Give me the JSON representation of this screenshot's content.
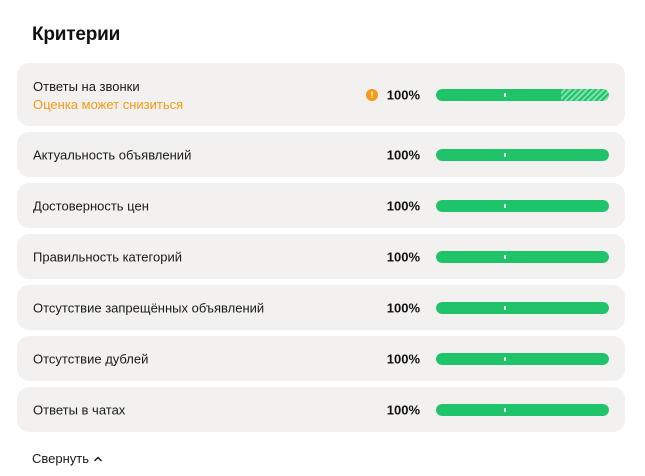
{
  "title": "Критерии",
  "colors": {
    "accent_green": "#1fc46a",
    "bar_track": "#dcdcdc",
    "warning_orange": "#f59a14",
    "row_bg": "#f2f1f0"
  },
  "criteria": [
    {
      "label": "Ответы на звонки",
      "warning": "Оценка может снизиться",
      "warning_icon": "exclamation-circle-icon",
      "percent_text": "100%",
      "level": 0.72,
      "striped_remainder": true
    },
    {
      "label": "Актуальность объявлений",
      "percent_text": "100%",
      "level": 1.0
    },
    {
      "label": "Достоверность цен",
      "percent_text": "100%",
      "level": 1.0
    },
    {
      "label": "Правильность категорий",
      "percent_text": "100%",
      "level": 1.0
    },
    {
      "label": "Отсутствие запрещённых объявлений",
      "percent_text": "100%",
      "level": 1.0
    },
    {
      "label": "Отсутствие дублей",
      "percent_text": "100%",
      "level": 1.0
    },
    {
      "label": "Ответы в чатах",
      "percent_text": "100%",
      "level": 1.0
    }
  ],
  "collapse": {
    "label": "Свернуть",
    "icon": "chevron-up-icon"
  }
}
